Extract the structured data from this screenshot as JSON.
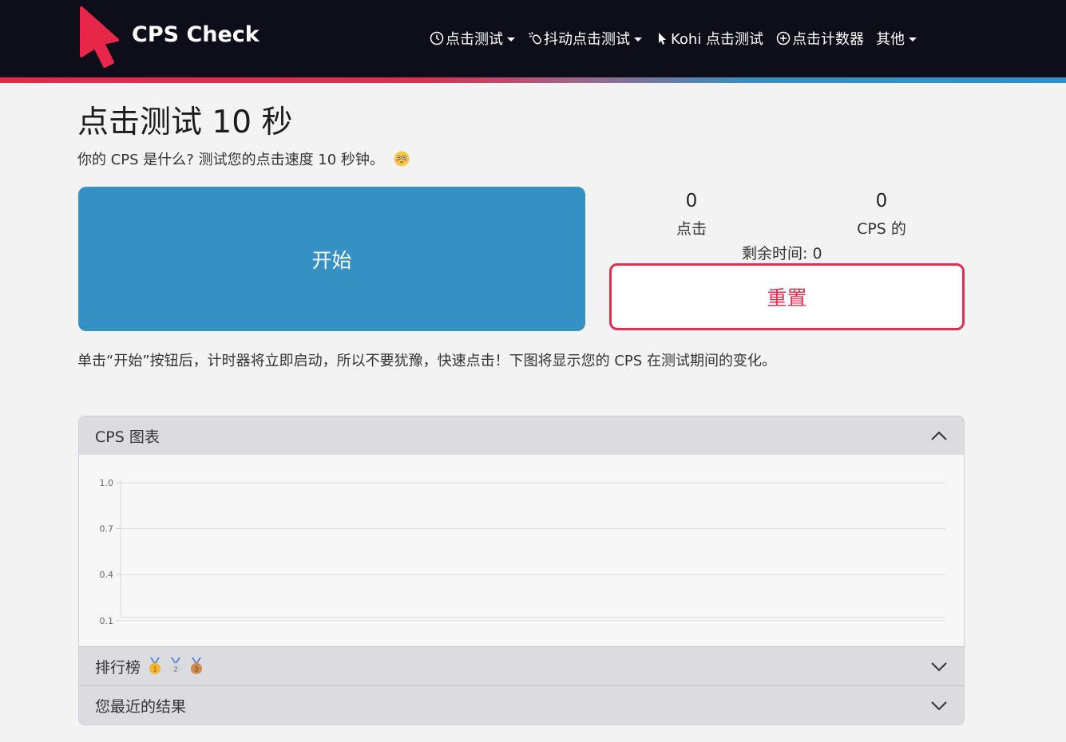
{
  "brand": {
    "name": "CPS Check",
    "accent": "#e8264a"
  },
  "nav": {
    "items": [
      {
        "label": "点击测试",
        "icon": "clock-icon",
        "dropdown": true
      },
      {
        "label": "抖动点击测试",
        "icon": "mouse-icon",
        "dropdown": true
      },
      {
        "label": "Kohi 点击测试",
        "icon": "cursor-icon",
        "dropdown": false
      },
      {
        "label": "点击计数器",
        "icon": "plus-circle-icon",
        "dropdown": false
      },
      {
        "label": "其他",
        "icon": "",
        "dropdown": true
      }
    ]
  },
  "page": {
    "title": "点击测试 10 秒",
    "subtitle": "你的 CPS 是什么? 测试您的点击速度 10 秒钟。",
    "subtitle_emoji": "flushed-face-icon"
  },
  "test": {
    "start_label": "开始",
    "clicks_value": "0",
    "clicks_label": "点击",
    "cps_value": "0",
    "cps_label": "CPS 的",
    "remaining_label": "剩余时间: ",
    "remaining_value": "0",
    "reset_label": "重置",
    "start_color": "#3591c3",
    "reset_color": "#df2e4f"
  },
  "info": "单击“开始”按钮后，计时器将立即启动，所以不要犹豫，快速点击！下图将显示您的 CPS 在测试期间的变化。",
  "accordion": {
    "chart_title": "CPS 图表",
    "leaderboard_title": "排行榜",
    "recent_title": "您最近的结果"
  },
  "chart_data": {
    "type": "line",
    "title": "",
    "xlabel": "",
    "ylabel": "",
    "ylim": [
      0,
      1.0
    ],
    "y_ticks": [
      "1.0",
      "0.7",
      "0.4",
      "0.1"
    ],
    "grid": true,
    "series": []
  }
}
